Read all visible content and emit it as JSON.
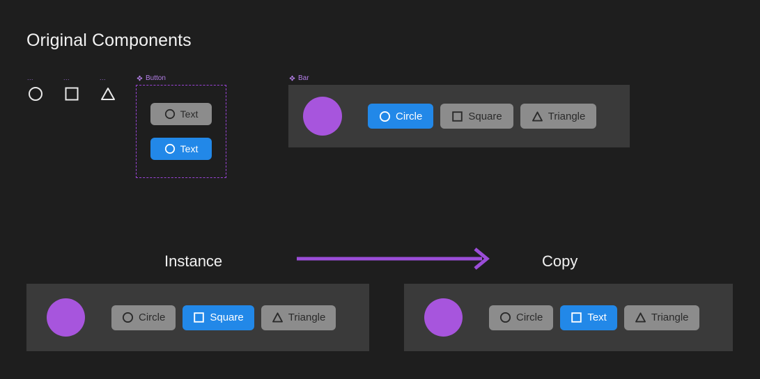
{
  "page": {
    "title": "Original Components",
    "background_color": "#1e1e1e",
    "accent_purple": "#9b44d8",
    "accent_blue": "#2288e8",
    "avatar_purple": "#a755dd",
    "panel_gray": "#3a3a3a",
    "button_gray": "#8c8c8c"
  },
  "shape_components": [
    {
      "name_truncated": "...",
      "icon": "circle-icon"
    },
    {
      "name_truncated": "...",
      "icon": "square-icon"
    },
    {
      "name_truncated": "...",
      "icon": "triangle-icon"
    }
  ],
  "button_component_set": {
    "label": "Button",
    "icon": "component-diamond-icon",
    "variants": [
      {
        "label": "Text",
        "icon": "circle-icon",
        "state": "default",
        "style": "gray"
      },
      {
        "label": "Text",
        "icon": "circle-icon",
        "state": "selected",
        "style": "blue"
      }
    ]
  },
  "bar_component": {
    "label": "Bar",
    "icon": "component-diamond-icon",
    "avatar": "avatar-circle",
    "buttons": [
      {
        "label": "Circle",
        "icon": "circle-icon",
        "style": "blue"
      },
      {
        "label": "Square",
        "icon": "square-icon",
        "style": "gray"
      },
      {
        "label": "Triangle",
        "icon": "triangle-icon",
        "style": "gray"
      }
    ]
  },
  "flow": {
    "from_label": "Instance",
    "to_label": "Copy",
    "arrow_icon": "right-arrow-icon",
    "arrow_color": "#9b4dd8"
  },
  "instance_frame": {
    "avatar": "avatar-circle",
    "buttons": [
      {
        "label": "Circle",
        "icon": "circle-icon",
        "style": "gray"
      },
      {
        "label": "Square",
        "icon": "square-icon",
        "style": "blue"
      },
      {
        "label": "Triangle",
        "icon": "triangle-icon",
        "style": "gray"
      }
    ]
  },
  "copy_frame": {
    "avatar": "avatar-circle",
    "buttons": [
      {
        "label": "Circle",
        "icon": "circle-icon",
        "style": "gray"
      },
      {
        "label": "Text",
        "icon": "square-icon",
        "style": "blue"
      },
      {
        "label": "Triangle",
        "icon": "triangle-icon",
        "style": "gray"
      }
    ]
  }
}
